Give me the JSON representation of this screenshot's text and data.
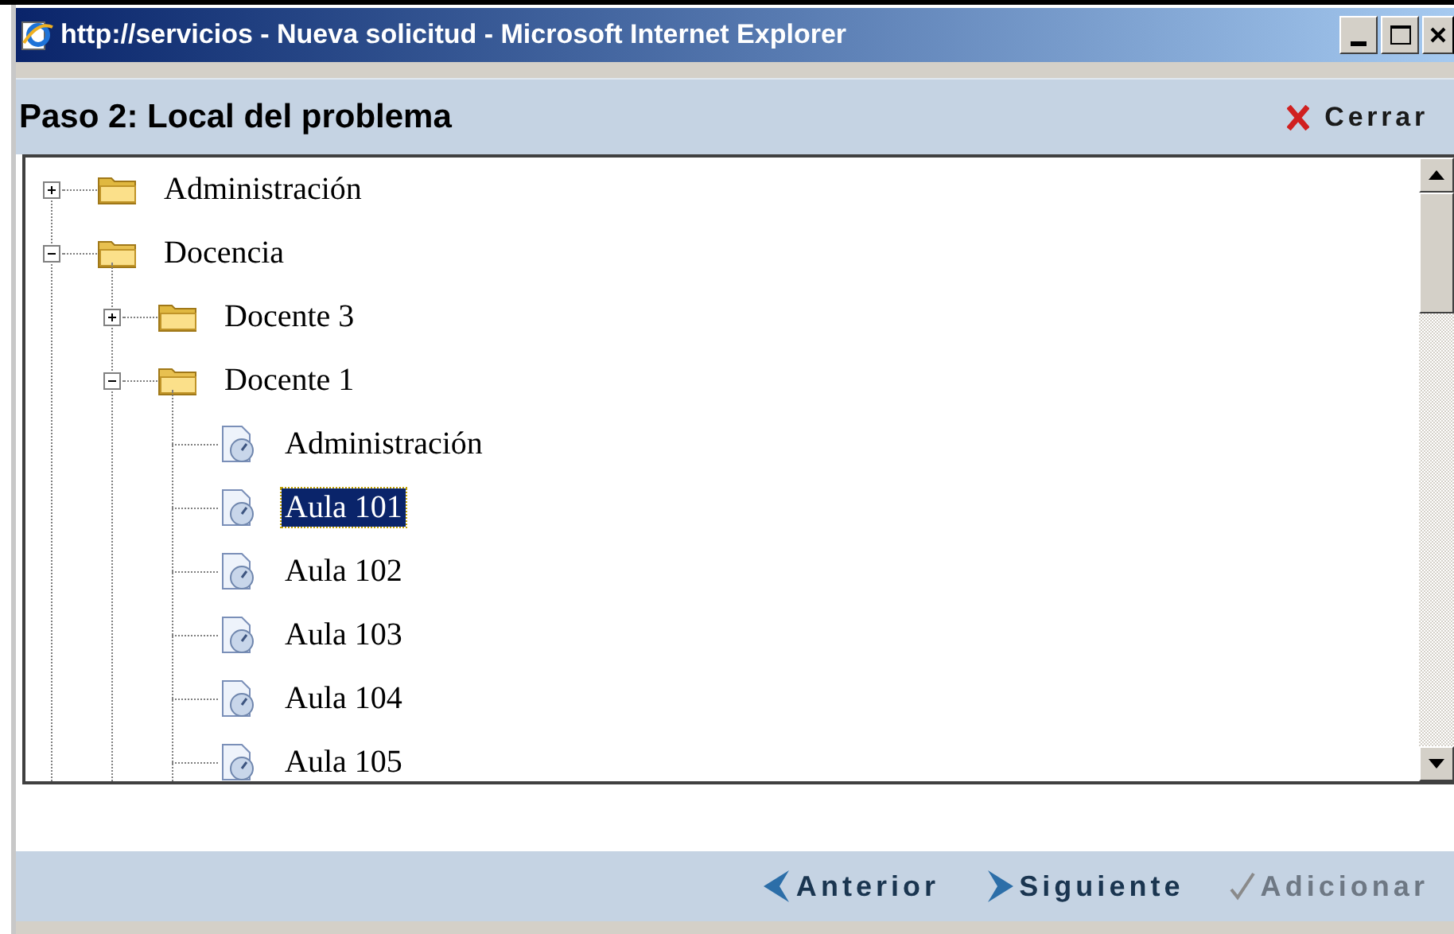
{
  "window": {
    "title": "http://servicios - Nueva solicitud - Microsoft Internet Explorer"
  },
  "header": {
    "title": "Paso 2: Local del problema",
    "close_label": "Cerrar"
  },
  "tree": [
    {
      "label": "Administración",
      "kind": "folder",
      "expanded": false,
      "selected": false
    },
    {
      "label": "Docencia",
      "kind": "folder",
      "expanded": true,
      "selected": false,
      "children": [
        {
          "label": "Docente 3",
          "kind": "folder",
          "expanded": false,
          "selected": false
        },
        {
          "label": "Docente 1",
          "kind": "folder",
          "expanded": true,
          "selected": false,
          "children": [
            {
              "label": "Administración",
              "kind": "room",
              "selected": false
            },
            {
              "label": "Aula 101",
              "kind": "room",
              "selected": true
            },
            {
              "label": "Aula 102",
              "kind": "room",
              "selected": false
            },
            {
              "label": "Aula 103",
              "kind": "room",
              "selected": false
            },
            {
              "label": "Aula 104",
              "kind": "room",
              "selected": false
            },
            {
              "label": "Aula 105",
              "kind": "room",
              "selected": false
            }
          ]
        }
      ]
    }
  ],
  "footer": {
    "buttons": [
      {
        "label": "Anterior",
        "kind": "back",
        "disabled": false
      },
      {
        "label": "Siguiente",
        "kind": "next",
        "disabled": false
      },
      {
        "label": "Adicionar",
        "kind": "add",
        "disabled": true
      }
    ]
  }
}
